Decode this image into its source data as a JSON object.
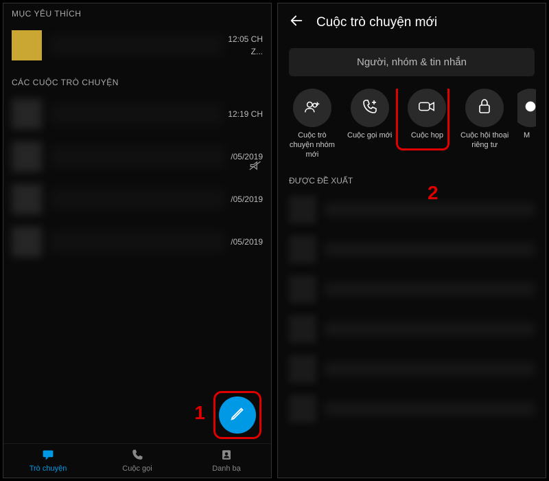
{
  "left": {
    "favorites_header": "MỤC YÊU THÍCH",
    "conversations_header": "CÁC CUỘC TRÒ CHUYỆN",
    "favorite_time": "12:05 CH",
    "favorite_sub": "Z...",
    "rows": [
      {
        "time": "12:19 CH"
      },
      {
        "time": "/05/2019",
        "muted": true
      },
      {
        "time": "/05/2019"
      },
      {
        "time": "/05/2019"
      }
    ],
    "annotation1": "1",
    "nav": {
      "chat": "Trò chuyện",
      "calls": "Cuộc gọi",
      "contacts": "Danh bạ"
    }
  },
  "right": {
    "title": "Cuộc trò chuyện mới",
    "search_placeholder": "Người, nhóm & tin nhắn",
    "actions": {
      "new_group_chat": "Cuộc trò chuyện nhóm mới",
      "new_call": "Cuộc gọi mới",
      "meeting": "Cuộc họp",
      "private_conv": "Cuộc hội thoại riêng tư",
      "more": "M"
    },
    "annotation2": "2",
    "suggested_header": "ĐƯỢC ĐỀ XUẤT"
  }
}
